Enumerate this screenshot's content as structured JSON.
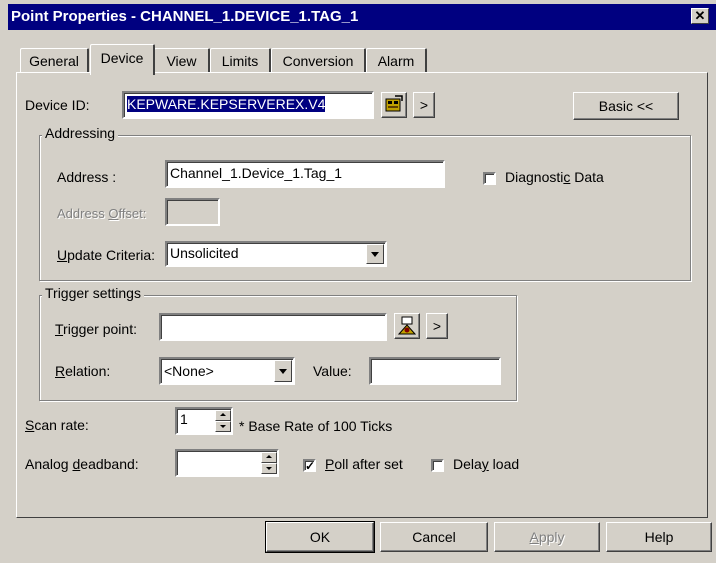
{
  "window": {
    "title": "Point Properties - CHANNEL_1.DEVICE_1.TAG_1",
    "close_glyph": "✕"
  },
  "tabs": [
    {
      "label": "General"
    },
    {
      "label": "Device",
      "active": true
    },
    {
      "label": "View"
    },
    {
      "label": "Limits"
    },
    {
      "label": "Conversion"
    },
    {
      "label": "Alarm"
    }
  ],
  "device": {
    "label": "Device ID:",
    "value": "KEPWARE.KEPSERVEREX.V4",
    "browse_icon": "device-browse-icon",
    "more_glyph": ">",
    "basic_button": "Basic <<"
  },
  "addressing": {
    "group_title": "Addressing",
    "address_label": "Address :",
    "address_value": "Channel_1.Device_1.Tag_1",
    "diagnostic_label": "Diagnostic Data",
    "diagnostic_checked": false,
    "offset_label": "Address Offset:",
    "offset_value": "",
    "update_label": "Update Criteria:",
    "update_value": "Unsolicited"
  },
  "trigger": {
    "group_title": "Trigger settings",
    "point_label": "Trigger point:",
    "point_value": "",
    "browse_icon": "tag-browse-icon",
    "more_glyph": ">",
    "relation_label": "Relation:",
    "relation_value": "<None>",
    "value_label": "Value:",
    "value_value": ""
  },
  "scan": {
    "label": "Scan rate:",
    "value": "1",
    "note": "* Base Rate of 100 Ticks"
  },
  "deadband": {
    "label": "Analog deadband:",
    "value": "",
    "poll_label": "Poll after set",
    "poll_checked": true,
    "delay_label": "Delay load",
    "delay_checked": false
  },
  "buttons": {
    "ok": "OK",
    "cancel": "Cancel",
    "apply": "Apply",
    "help": "Help"
  }
}
